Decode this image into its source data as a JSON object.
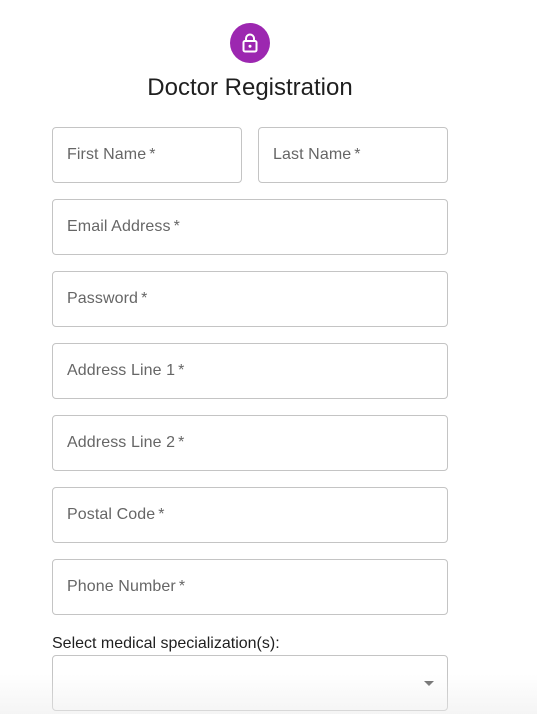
{
  "header": {
    "icon": "lock-icon",
    "icon_color": "#9c27b0",
    "title": "Doctor Registration"
  },
  "form": {
    "required_marker": "*",
    "first_name": {
      "label": "First Name"
    },
    "last_name": {
      "label": "Last Name"
    },
    "email": {
      "label": "Email Address"
    },
    "password": {
      "label": "Password"
    },
    "address_line_1": {
      "label": "Address Line 1"
    },
    "address_line_2": {
      "label": "Address Line 2"
    },
    "postal_code": {
      "label": "Postal Code"
    },
    "phone_number": {
      "label": "Phone Number"
    },
    "specialization": {
      "label": "Select medical specialization(s):",
      "selected_value": ""
    }
  }
}
